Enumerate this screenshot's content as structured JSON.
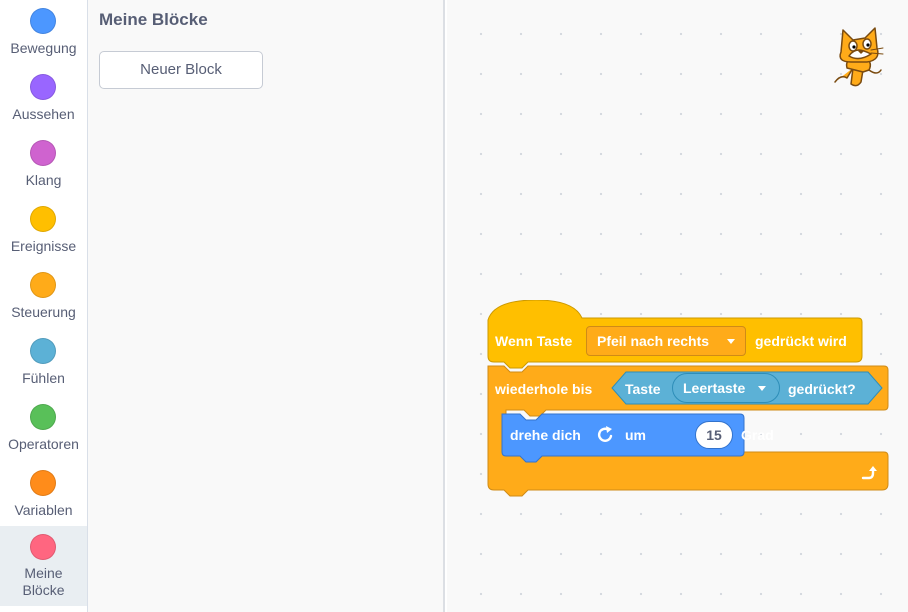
{
  "categories": [
    {
      "label": "Bewegung",
      "color": "#4c97ff"
    },
    {
      "label": "Aussehen",
      "color": "#9966ff"
    },
    {
      "label": "Klang",
      "color": "#cf63cf"
    },
    {
      "label": "Ereignisse",
      "color": "#ffbf00"
    },
    {
      "label": "Steuerung",
      "color": "#ffab19"
    },
    {
      "label": "Fühlen",
      "color": "#5cb1d6"
    },
    {
      "label": "Operatoren",
      "color": "#59c059"
    },
    {
      "label": "Variablen",
      "color": "#ff8c1a"
    },
    {
      "label": "Meine Blöcke",
      "color": "#ff6680",
      "selected": true
    }
  ],
  "palette": {
    "title": "Meine Blöcke",
    "new_block_button": "Neuer Block"
  },
  "script": {
    "hat": {
      "prefix": "Wenn Taste",
      "key_dropdown": "Pfeil nach rechts",
      "suffix": "gedrückt wird",
      "color": "#ffbf00"
    },
    "repeat_until": {
      "label": "wiederhole bis",
      "color": "#ffab19",
      "condition": {
        "prefix": "Taste",
        "key_dropdown": "Leertaste",
        "suffix": "gedrückt?",
        "color": "#5cb1d6"
      }
    },
    "turn": {
      "prefix": "drehe dich",
      "icon": "rotate-right-icon",
      "middle": "um",
      "degrees": "15",
      "suffix": "Grad",
      "color": "#4c97ff"
    },
    "loop_icon": "loop-arrow-icon"
  },
  "sprite": {
    "icon": "scratch-cat-icon"
  }
}
